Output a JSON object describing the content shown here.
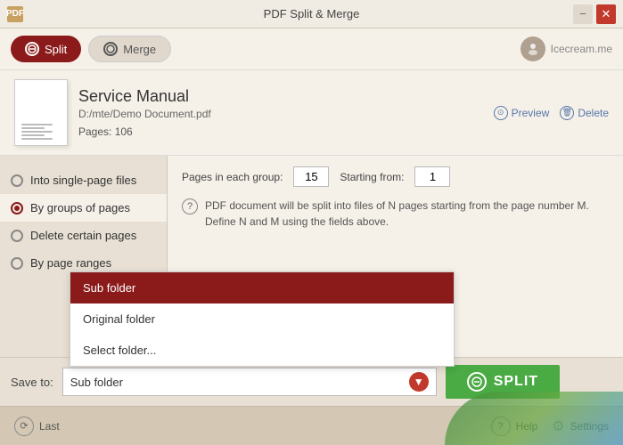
{
  "titlebar": {
    "title": "PDF Split & Merge",
    "minimize_label": "−",
    "close_label": "✕",
    "app_icon": "PDF"
  },
  "tabs": {
    "split_label": "Split",
    "merge_label": "Merge"
  },
  "logo": {
    "text": "Icecream.me"
  },
  "file": {
    "title": "Service Manual",
    "path": "D:/mte/Demo Document.pdf",
    "pages_label": "Pages: 106",
    "preview_label": "Preview",
    "delete_label": "Delete"
  },
  "options": [
    {
      "id": "single",
      "label": "Into single-page files",
      "checked": false
    },
    {
      "id": "groups",
      "label": "By groups of pages",
      "checked": true
    },
    {
      "id": "delete",
      "label": "Delete certain pages",
      "checked": false
    },
    {
      "id": "ranges",
      "label": "By page ranges",
      "checked": false
    }
  ],
  "fields": {
    "pages_label": "Pages in each group:",
    "pages_value": "15",
    "starting_label": "Starting from:",
    "starting_value": "1"
  },
  "info_text": "PDF document will be split into files of N pages starting from the page number M. Define N and M using the fields above.",
  "save": {
    "label": "Save to:",
    "current_value": "Sub folder"
  },
  "dropdown_items": [
    {
      "label": "Sub folder",
      "selected": true
    },
    {
      "label": "Original folder",
      "selected": false
    },
    {
      "label": "Select folder...",
      "selected": false
    }
  ],
  "split_button": "SPLIT",
  "footer": {
    "last_label": "Last",
    "help_label": "Help",
    "settings_label": "Settings"
  }
}
